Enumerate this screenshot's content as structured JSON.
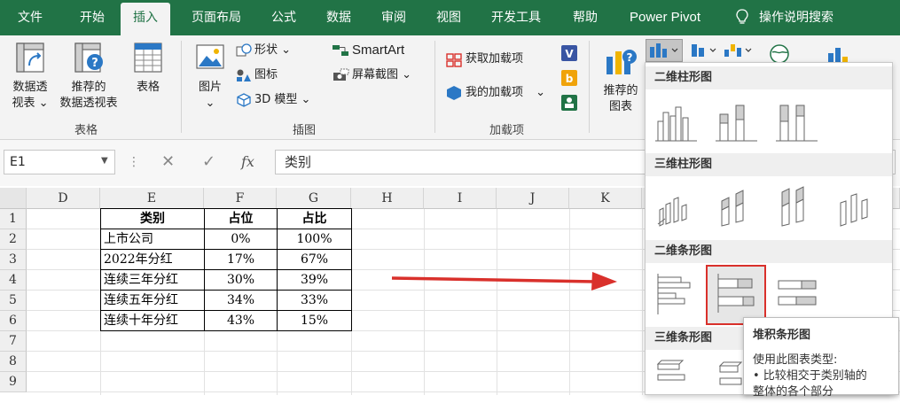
{
  "menu": {
    "tabs": [
      "文件",
      "开始",
      "插入",
      "页面布局",
      "公式",
      "数据",
      "审阅",
      "视图",
      "开发工具",
      "帮助",
      "Power Pivot"
    ],
    "active": "插入",
    "search": "操作说明搜索"
  },
  "ribbon": {
    "pivot_line1": "数据透",
    "pivot_line2": "视表",
    "rec_pivot_line1": "推荐的",
    "rec_pivot_line2": "数据透视表",
    "table": "表格",
    "group_table": "表格",
    "picture": "图片",
    "shapes": "形状",
    "icons": "图标",
    "model3d": "3D 模型",
    "smartart": "SmartArt",
    "screenshot": "屏幕截图",
    "group_illustrations": "插图",
    "get_addins": "获取加载项",
    "my_addins": "我的加载项",
    "group_addins": "加载项",
    "rec_chart_line1": "推荐的",
    "rec_chart_line2": "图表"
  },
  "formula_bar": {
    "name_box": "E1",
    "fx": "fx",
    "value": "类别"
  },
  "grid": {
    "columns": [
      "D",
      "E",
      "F",
      "G",
      "H",
      "I",
      "J",
      "K"
    ],
    "rows": [
      "1",
      "2",
      "3",
      "4",
      "5",
      "6",
      "7",
      "8",
      "9"
    ],
    "table": {
      "headers": [
        "类别",
        "占位",
        "占比"
      ],
      "rows": [
        [
          "上市公司",
          "0%",
          "100%"
        ],
        [
          "2022年分红",
          "17%",
          "67%"
        ],
        [
          "连续三年分红",
          "30%",
          "39%"
        ],
        [
          "连续五年分红",
          "34%",
          "33%"
        ],
        [
          "连续十年分红",
          "43%",
          "15%"
        ]
      ]
    }
  },
  "dropdown": {
    "sections": [
      "二维柱形图",
      "三维柱形图",
      "二维条形图",
      "三维条形图"
    ]
  },
  "tooltip": {
    "title": "堆积条形图",
    "line1": "使用此图表类型:",
    "line2": "• 比较相交于类别轴的",
    "line3": "整体的各个部分"
  },
  "colors": {
    "accent": "#217346",
    "highlight": "#d9302b"
  }
}
